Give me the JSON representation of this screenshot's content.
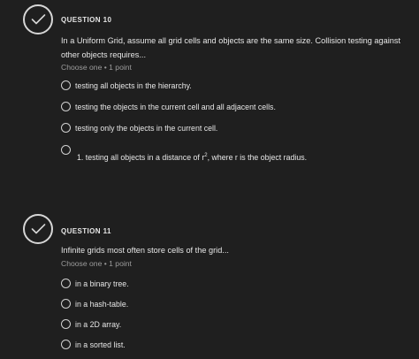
{
  "questions": [
    {
      "label": "QUESTION 10",
      "text": "In a Uniform Grid, assume all grid cells and objects are the same size. Collision testing against other objects requires...",
      "meta": "Choose one • 1 point",
      "options": [
        "testing all objects in the hierarchy.",
        "testing the objects in the current cell and all adjacent cells.",
        "testing only the objects in the current cell."
      ],
      "option_4": {
        "prefix": "1. testing all objects in a distance of r",
        "sup": "2",
        "suffix": ", where r is the object radius."
      }
    },
    {
      "label": "QUESTION 11",
      "text": "Infinite grids most often store cells of the grid...",
      "meta": "Choose one • 1 point",
      "options": [
        "in a binary tree.",
        "in a hash-table.",
        "in a 2D array.",
        "in a sorted list."
      ]
    }
  ],
  "colors": {
    "background": "#1f1f1f",
    "text": "#e6e6e6",
    "muted": "#9c9c9c",
    "badge": "#d6d6d6"
  },
  "icons": {
    "badge": "check-icon",
    "radio": "radio-empty-icon"
  }
}
